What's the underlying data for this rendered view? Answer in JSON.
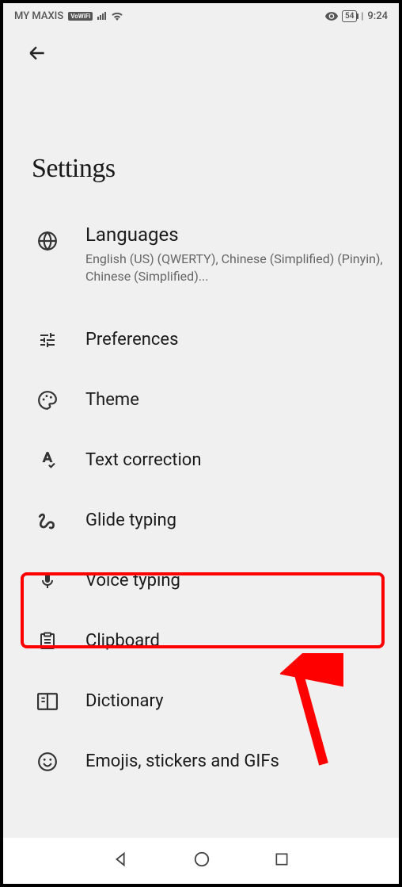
{
  "status_bar": {
    "carrier": "MY MAXIS",
    "vowifi": "VoWiFi",
    "time": "9:24",
    "battery": "54"
  },
  "page": {
    "title": "Settings"
  },
  "items": {
    "languages": {
      "label": "Languages",
      "subtitle": "English (US) (QWERTY), Chinese (Simplified) (Pinyin), Chinese (Simplified)..."
    },
    "preferences": {
      "label": "Preferences"
    },
    "theme": {
      "label": "Theme"
    },
    "text_correction": {
      "label": "Text correction"
    },
    "glide_typing": {
      "label": "Glide typing"
    },
    "voice_typing": {
      "label": "Voice typing"
    },
    "clipboard": {
      "label": "Clipboard"
    },
    "dictionary": {
      "label": "Dictionary"
    },
    "emojis": {
      "label": "Emojis, stickers and GIFs"
    }
  }
}
